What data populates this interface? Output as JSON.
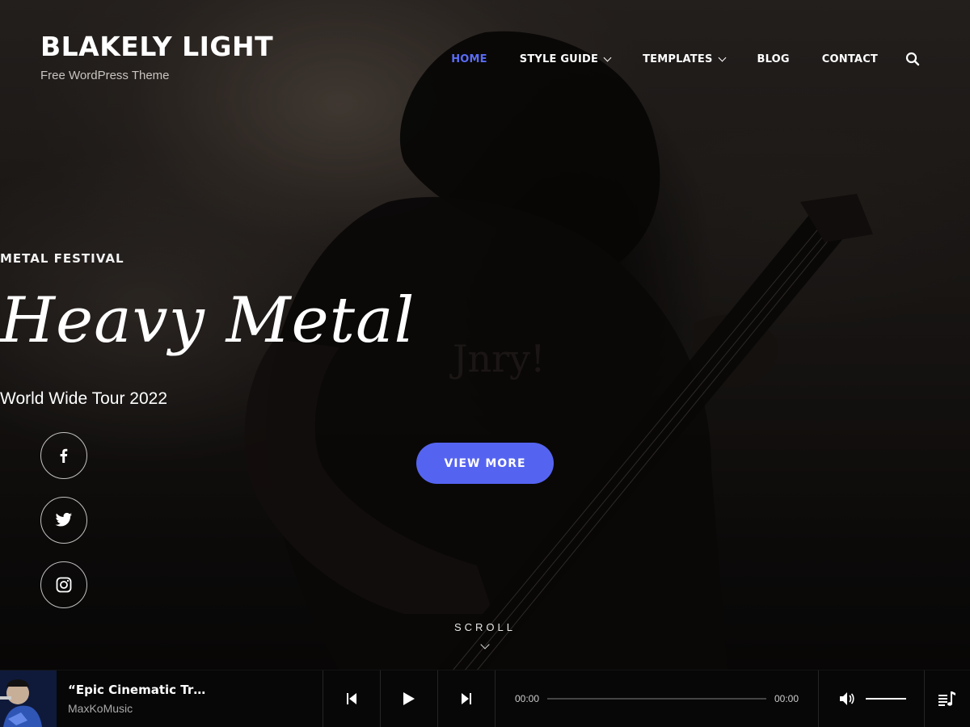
{
  "header": {
    "site_title": "BLAKELY LIGHT",
    "tagline": "Free WordPress Theme"
  },
  "nav": {
    "items": [
      {
        "label": "HOME",
        "active": true,
        "dropdown": false
      },
      {
        "label": "STYLE GUIDE",
        "active": false,
        "dropdown": true
      },
      {
        "label": "TEMPLATES",
        "active": false,
        "dropdown": true
      },
      {
        "label": "BLOG",
        "active": false,
        "dropdown": false
      },
      {
        "label": "CONTACT",
        "active": false,
        "dropdown": false
      }
    ],
    "search_icon": "search-icon"
  },
  "hero": {
    "eyebrow": "METAL FESTIVAL",
    "title": "Heavy Metal",
    "subtitle": "World Wide Tour 2022",
    "cta_label": "VIEW MORE"
  },
  "social": {
    "icons": [
      "facebook-icon",
      "twitter-icon",
      "instagram-icon"
    ]
  },
  "scroll": {
    "label": "SCROLL"
  },
  "player": {
    "track_title": "“Epic Cinematic Tr…",
    "artist": "MaxKoMusic",
    "current_time": "00:00",
    "duration": "00:00",
    "progress": 0,
    "volume": 1.0
  },
  "colors": {
    "accent": "#5564f0",
    "nav_active": "#5a6cf5",
    "text": "#ffffff",
    "player_bg": "#080808"
  }
}
